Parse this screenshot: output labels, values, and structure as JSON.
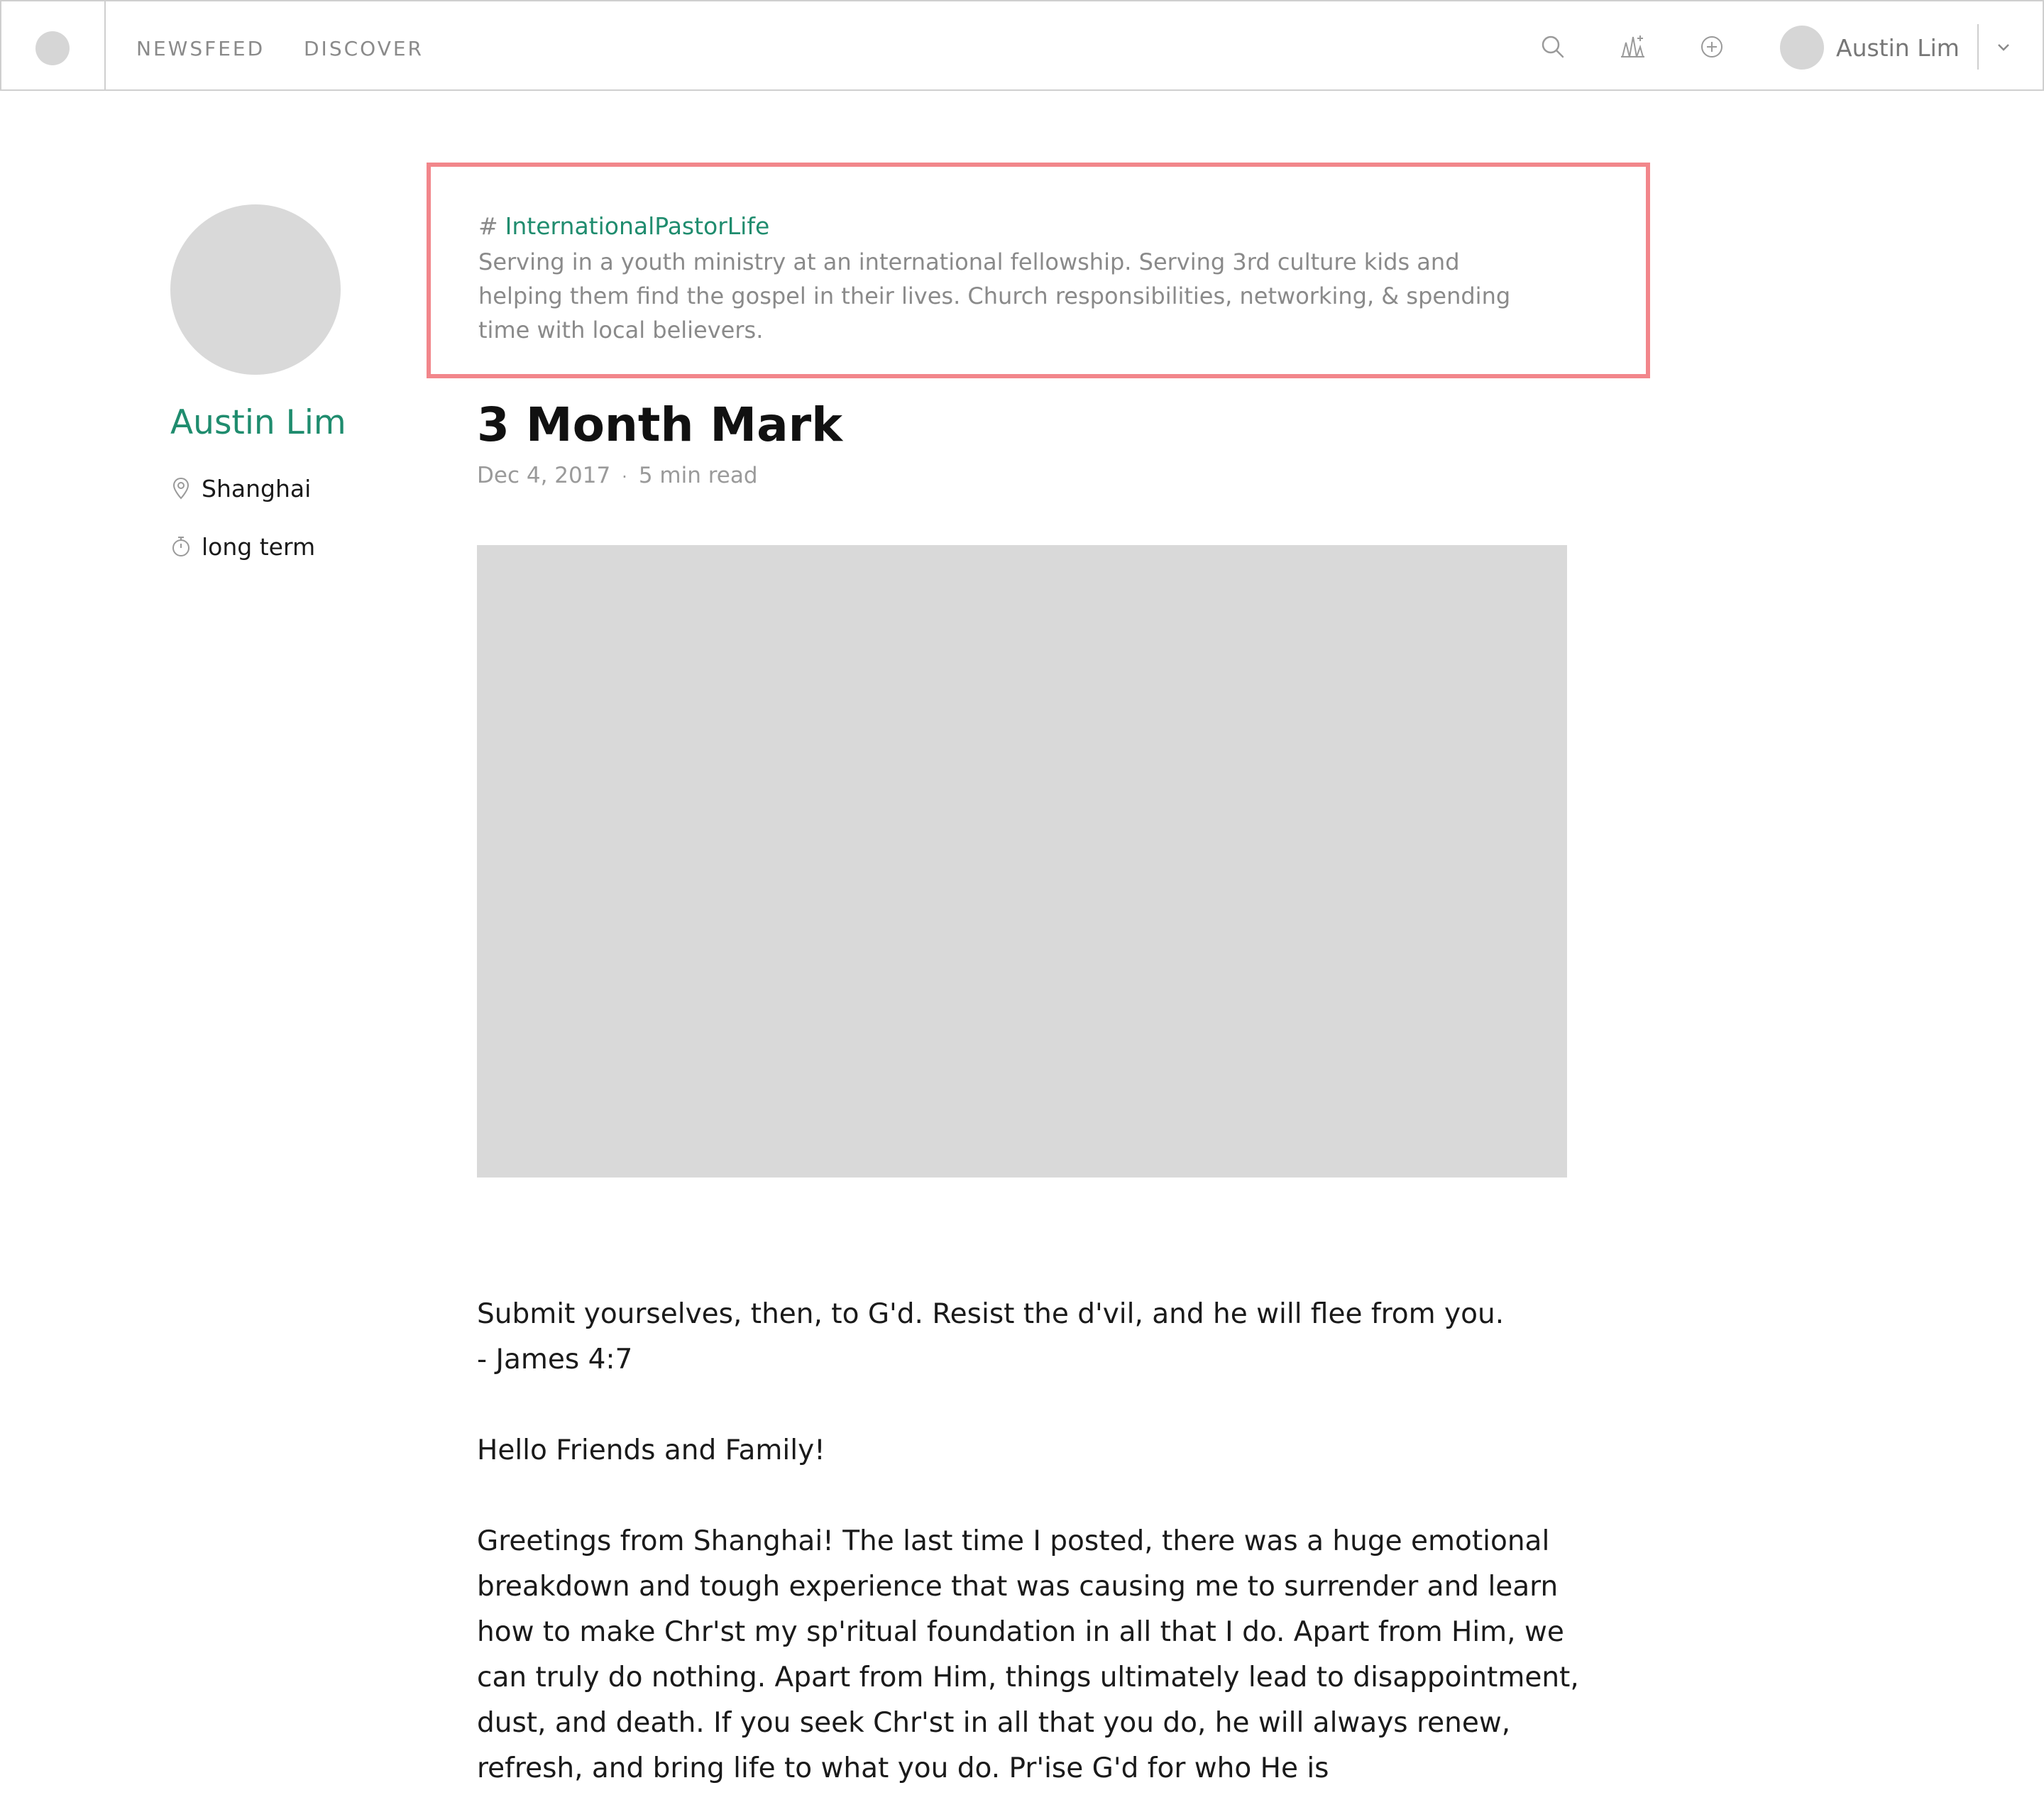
{
  "nav": {
    "newsfeed": "NEWSFEED",
    "discover": "DISCOVER"
  },
  "user": {
    "name": "Austin Lim"
  },
  "icons": {
    "search": "search-icon",
    "stats": "stats-icon",
    "add": "add-circle-icon",
    "chevron": "chevron-down-icon",
    "location": "location-pin-icon",
    "timer": "stopwatch-icon"
  },
  "profile": {
    "name": "Austin Lim",
    "location": "Shanghai",
    "term": "long term"
  },
  "topic": {
    "hash": "#",
    "tag": "InternationalPastorLife",
    "description": "Serving in a youth ministry at an international fellowship. Serving 3rd culture kids and helping them find the gospel in their lives. Church responsibilities, networking, & spending time with local believers."
  },
  "article": {
    "title": "3 Month Mark",
    "date": "Dec 4, 2017",
    "dot": "·",
    "read_time": "5 min read",
    "verse": "Submit yourselves, then, to G'd. Resist the d'vil, and he will flee from you.",
    "verse_ref": "- James 4:7",
    "greeting": "Hello Friends and Family!",
    "paragraph1": "Greetings from Shanghai! The last time I posted, there was a huge emotional breakdown and tough experience that was causing me to surrender and learn how to make Chr'st my sp'ritual foundation in all that I do. Apart from Him, we can truly do nothing. Apart from Him, things ultimately lead to disappointment, dust, and death. If you seek Chr'st in all that you do, he will always renew, refresh, and bring life to what you do. Pr'ise G'd for who He is"
  },
  "colors": {
    "accent": "#1f8c6e",
    "highlight_border": "#f2868b",
    "placeholder": "#d9d9d9",
    "muted_text": "#8a8a8a"
  }
}
